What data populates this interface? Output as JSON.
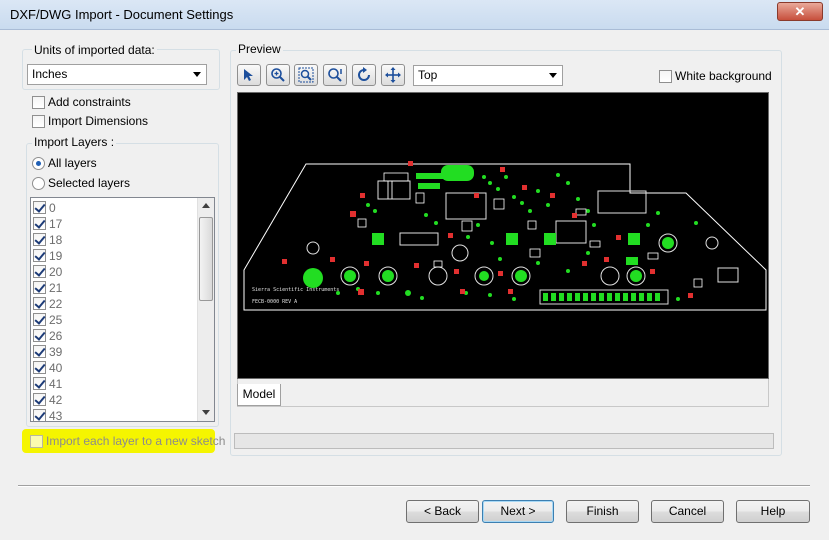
{
  "window": {
    "title": "DXF/DWG Import - Document Settings",
    "close_glyph": "✕"
  },
  "units": {
    "label": "Units of imported data:",
    "selected": "Inches"
  },
  "options": {
    "add_constraints": "Add constraints",
    "import_dimensions": "Import Dimensions"
  },
  "import_layers": {
    "label": "Import Layers :",
    "all_layers": "All layers",
    "selected_layers": "Selected layers",
    "layers": [
      "0",
      "17",
      "18",
      "19",
      "20",
      "21",
      "22",
      "25",
      "26",
      "39",
      "40",
      "41",
      "42",
      "43"
    ]
  },
  "sketch_option": {
    "label": "Import each layer to a new sketch",
    "highlight_color": "#f5f500"
  },
  "preview": {
    "label": "Preview",
    "view_selected": "Top",
    "white_background": "White background",
    "model_tab": "Model",
    "board_text_1": "Sierra Scientific Instruments",
    "board_text_2": "FECB-0000 REV A",
    "tools": [
      "select-icon",
      "zoom-in-icon",
      "zoom-window-icon",
      "zoom-fit-icon",
      "rotate-icon",
      "pan-icon"
    ]
  },
  "buttons": {
    "back": "< Back",
    "next": "Next >",
    "finish": "Finish",
    "cancel": "Cancel",
    "help": "Help"
  }
}
